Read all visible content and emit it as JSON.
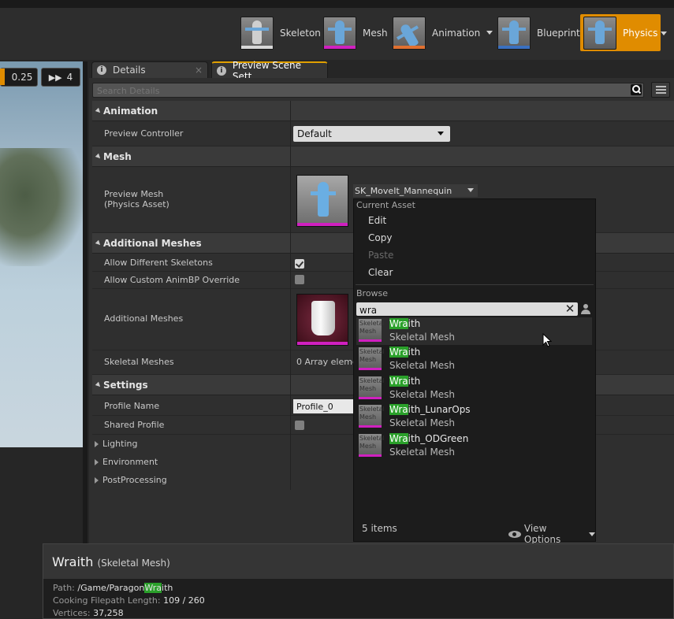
{
  "toolbar": {
    "modes": [
      {
        "label": "Skeleton",
        "icon": "skeleton-icon"
      },
      {
        "label": "Mesh",
        "icon": "mesh-icon"
      },
      {
        "label": "Animation",
        "icon": "animation-icon"
      },
      {
        "label": "Blueprint",
        "icon": "blueprint-icon"
      },
      {
        "label": "Physics",
        "icon": "physics-icon",
        "active": true
      }
    ],
    "accent": "#e08c00"
  },
  "viewport": {
    "speed_value": "0.25",
    "camera_speed_value": "4"
  },
  "tabs": [
    {
      "label": "Details",
      "close": "×"
    },
    {
      "label": "Preview Scene Sett",
      "close": "×",
      "active": true
    }
  ],
  "search": {
    "placeholder": "Search Details"
  },
  "animation": {
    "header": "Animation",
    "preview_controller_label": "Preview Controller",
    "preview_controller_value": "Default"
  },
  "mesh": {
    "header": "Mesh",
    "preview_mesh_label_1": "Preview Mesh",
    "preview_mesh_label_2": "(Physics Asset)",
    "preview_mesh_value": "SK_MoveIt_Mannequin"
  },
  "additional_meshes": {
    "header": "Additional Meshes",
    "allow_different_skeletons": "Allow Different Skeletons",
    "allow_custom_animbp": "Allow Custom AnimBP Override",
    "additional_meshes_label": "Additional Meshes",
    "skeletal_meshes_label": "Skeletal Meshes",
    "skeletal_meshes_value": "0 Array eleme"
  },
  "settings": {
    "header": "Settings",
    "profile_name_label": "Profile Name",
    "profile_name_value": "Profile_0",
    "shared_profile_label": "Shared Profile",
    "lighting": "Lighting",
    "environment": "Environment",
    "postprocessing": "PostProcessing"
  },
  "popup": {
    "current_asset": "Current Asset",
    "edit": "Edit",
    "copy": "Copy",
    "paste": "Paste",
    "clear": "Clear",
    "browse": "Browse",
    "filter_value": "wra",
    "results": [
      {
        "match": "Wra",
        "rest": "ith",
        "type": "Skeletal Mesh"
      },
      {
        "match": "Wra",
        "rest": "ith",
        "type": "Skeletal Mesh"
      },
      {
        "match": "Wra",
        "rest": "ith",
        "type": "Skeletal Mesh"
      },
      {
        "match": "Wra",
        "rest": "ith_LunarOps",
        "type": "Skeletal Mesh"
      },
      {
        "match": "Wra",
        "rest": "ith_ODGreen",
        "type": "Skeletal Mesh"
      }
    ],
    "thumb_label": "Skeletal Mesh",
    "item_count": "5 items",
    "view_options": "View Options"
  },
  "tooltip": {
    "title": "Wraith",
    "subtitle": "(Skeletal Mesh)",
    "path_label": "Path:",
    "path_prefix": "/Game/Paragon",
    "path_match": "Wra",
    "path_suffix": "ith",
    "cooking_label": "Cooking Filepath Length:",
    "cooking_value": "109 / 260",
    "vertices_label": "Vertices:",
    "vertices_value": "37,258"
  },
  "colors": {
    "highlight": "#2aa02a",
    "mesh_bar": "#d020c0"
  }
}
